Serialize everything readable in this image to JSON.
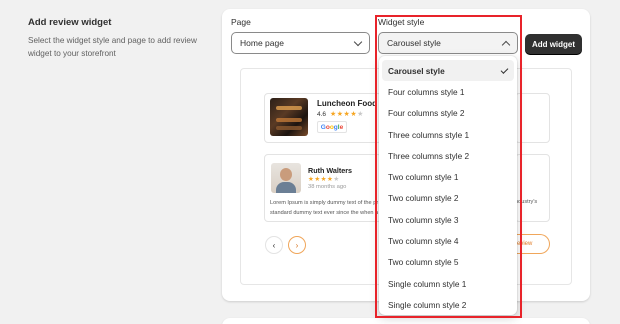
{
  "section": {
    "title": "Add review widget",
    "description": "Select the widget style and page to add review widget to your storefront"
  },
  "form": {
    "page_label": "Page",
    "page_value": "Home page",
    "style_label": "Widget style",
    "style_value": "Carousel style",
    "add_button": "Add widget"
  },
  "preview": {
    "business_name": "Luncheon Food &",
    "rating": "4.6",
    "stars_on": "★★★★",
    "stars_off": "★",
    "reviewer_name": "Ruth Walters",
    "reviewer_stars_on": "★★★★",
    "reviewer_stars_off": "★",
    "review_time": "38 months ago",
    "review_text_line1": "Lorem Ipsum is simply dummy text of the pri",
    "review_text_line2": "standard dummy text ever since the when an",
    "review_text_right": "ndustry's",
    "write_review": "eview",
    "prev": "‹",
    "next": "›"
  },
  "dropdown": {
    "items": [
      "Carousel style",
      "Four columns style 1",
      "Four columns style 2",
      "Three columns style 1",
      "Three columns style 2",
      "Two column style 1",
      "Two column style 2",
      "Two column style 3",
      "Two column style 4",
      "Two column style 5",
      "Single column style 1",
      "Single column style 2"
    ],
    "selected_index": 0
  },
  "colors": {
    "highlight": "#e8232a",
    "accent_orange": "#f0a65a",
    "star": "#f6a623",
    "button_dark": "#303030"
  }
}
